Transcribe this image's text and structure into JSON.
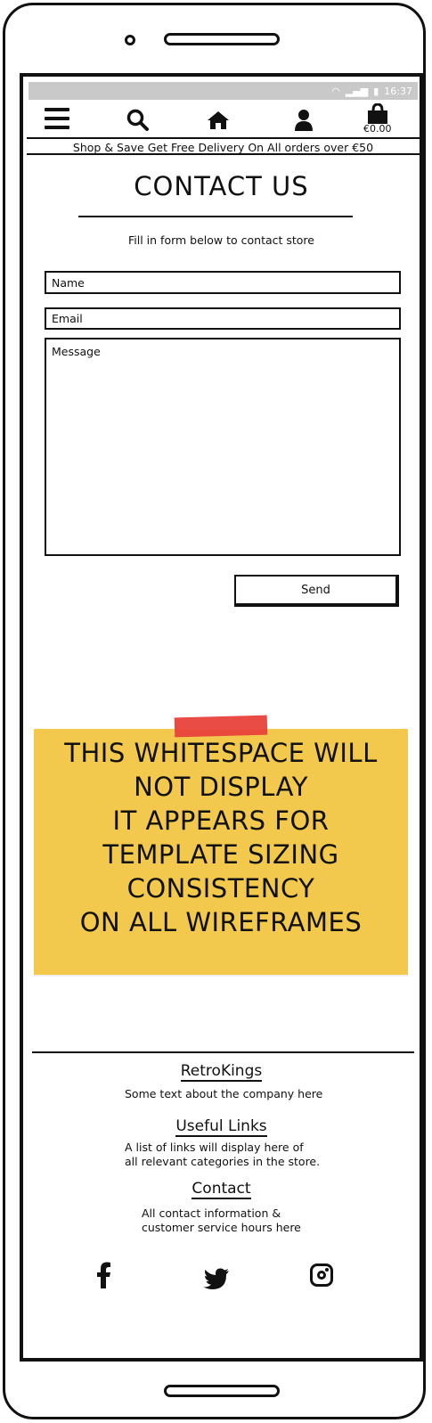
{
  "statusbar": {
    "wifi_icon": "wifi-icon",
    "signal_icon": "signal-icon",
    "battery_icon": "battery-icon",
    "time": "16:37"
  },
  "nav": {
    "menu_icon": "hamburger-menu-icon",
    "search_icon": "search-icon",
    "home_icon": "home-icon",
    "account_icon": "user-icon",
    "cart_icon": "shopping-bag-icon",
    "cart_total": "€0.00"
  },
  "banner": "Shop & Save Get Free Delivery On All orders over €50",
  "page": {
    "title": "CONTACT US",
    "subtitle": "Fill in form below to contact store"
  },
  "form": {
    "name_placeholder": "Name",
    "email_placeholder": "Email",
    "message_placeholder": "Message",
    "send_label": "Send"
  },
  "sticky_note": {
    "text": "THIS WHITESPACE WILL\nNOT DISPLAY\nIT APPEARS FOR\nTEMPLATE SIZING\nCONSISTENCY\nON ALL WIREFRAMES",
    "color": "#f2c94c",
    "tape_color": "#e8413b"
  },
  "footer": {
    "about_heading": "RetroKings",
    "about_text": "Some text about the company here",
    "links_heading": "Useful Links",
    "links_text_1": "A list of links will display here of",
    "links_text_2": "all relevant categories in the store.",
    "contact_heading": "Contact",
    "contact_text_1": "All contact information &",
    "contact_text_2": "customer service hours here",
    "social": [
      "facebook-icon",
      "twitter-icon",
      "instagram-icon"
    ]
  }
}
